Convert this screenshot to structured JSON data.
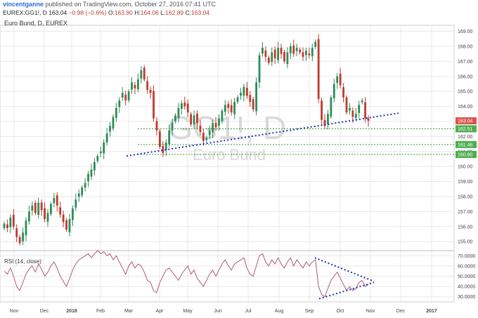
{
  "header": {
    "user": "vincentganne",
    "published": "published on TradingView.com, October 27, 2016 07:41 UTC",
    "symbol": "EUREX:GG1!, D",
    "last": "163.04",
    "change": "−0.98 (−0.6%)",
    "o_label": "O:",
    "open": "163.90",
    "h_label": "H:",
    "high": "164.06",
    "l_label": "L:",
    "low": "162.89",
    "c_label": "C:",
    "close": "163.04"
  },
  "chart_title": "Euro Bund, D, EUREX",
  "watermark": {
    "symbol": "GG1!, D",
    "name": "Euro Bund"
  },
  "rsi_title": "RSI (14, close)",
  "colors": {
    "up": "#2e8b57",
    "down": "#c0392b",
    "rsi": "#b05a7a",
    "trendline": "#1a2fb8",
    "support": "#3a9a3a",
    "price_tag": "#d9534f",
    "support_tag": "#4caf50",
    "grid": "#e8e8e8"
  },
  "chart_data": [
    {
      "type": "candlestick",
      "title": "Euro Bund, D, EUREX",
      "ylim": [
        154.4,
        169.4
      ],
      "y_ticks": [
        "155.00",
        "156.00",
        "157.00",
        "158.00",
        "159.00",
        "160.00",
        "161.00",
        "162.00",
        "163.00",
        "164.00",
        "165.00",
        "166.00",
        "167.00",
        "168.00",
        "169.00"
      ],
      "x_ticks": [
        "Nov",
        "Dec",
        "2016",
        "Feb",
        "Mar",
        "Apr",
        "May",
        "Jun",
        "Jul",
        "Aug",
        "Sep",
        "Oct",
        "Nov",
        "Dec",
        "2017"
      ],
      "last_price": "163.04",
      "support_levels": [
        "162.51",
        "161.46",
        "160.80"
      ],
      "trendline": {
        "start": [
          "Mar",
          160.7
        ],
        "end": [
          "Nov",
          163.55
        ]
      },
      "close_series": [
        156.2,
        155.9,
        156.6,
        156.0,
        155.3,
        154.9,
        155.6,
        156.4,
        157.0,
        157.4,
        156.9,
        157.6,
        157.1,
        156.5,
        156.9,
        157.5,
        157.9,
        157.4,
        156.8,
        156.3,
        155.8,
        156.5,
        157.2,
        157.8,
        158.2,
        158.6,
        158.9,
        159.5,
        159.8,
        160.3,
        160.7,
        161.0,
        161.6,
        162.2,
        162.7,
        163.3,
        163.9,
        164.4,
        164.9,
        164.4,
        165.0,
        165.6,
        165.2,
        165.8,
        166.4,
        165.8,
        165.1,
        164.9,
        163.2,
        162.4,
        161.3,
        160.9,
        161.6,
        162.4,
        162.9,
        163.4,
        163.9,
        164.2,
        164.0,
        163.6,
        162.8,
        163.4,
        162.9,
        162.3,
        161.7,
        161.9,
        162.4,
        162.9,
        162.6,
        163.2,
        163.7,
        164.1,
        163.9,
        163.6,
        164.3,
        164.6,
        164.9,
        165.3,
        164.7,
        164.3,
        163.8,
        165.6,
        167.4,
        167.9,
        167.3,
        166.9,
        167.6,
        167.2,
        167.9,
        167.5,
        167.0,
        167.6,
        168.0,
        167.5,
        167.9,
        167.6,
        167.3,
        167.7,
        167.4,
        167.9,
        168.3,
        164.5,
        163.1,
        162.7,
        163.5,
        164.6,
        165.5,
        166.0,
        165.4,
        164.6,
        163.6,
        163.9,
        163.3,
        163.5,
        164.1,
        164.4,
        163.2,
        163.04
      ],
      "rsi_ylim": [
        25,
        75
      ],
      "rsi_ticks": [
        "30.0000",
        "40.0000",
        "50.0000",
        "60.0000",
        "70.0000"
      ],
      "rsi_series": [
        55,
        52,
        58,
        50,
        40,
        36,
        44,
        52,
        57,
        60,
        54,
        62,
        57,
        50,
        54,
        60,
        64,
        58,
        50,
        45,
        40,
        48,
        56,
        62,
        66,
        68,
        70,
        72,
        68,
        72,
        75,
        72,
        74,
        70,
        72,
        66,
        70,
        64,
        58,
        52,
        60,
        64,
        58,
        62,
        60,
        54,
        46,
        44,
        36,
        34,
        44,
        50,
        56,
        58,
        54,
        50,
        46,
        52,
        56,
        60,
        52,
        56,
        48,
        44,
        40,
        46,
        52,
        56,
        50,
        56,
        62,
        66,
        60,
        56,
        62,
        64,
        66,
        68,
        58,
        52,
        50,
        60,
        70,
        72,
        64,
        60,
        66,
        62,
        68,
        62,
        58,
        64,
        68,
        60,
        66,
        62,
        58,
        64,
        60,
        64,
        66,
        40,
        32,
        30,
        38,
        46,
        50,
        54,
        48,
        42,
        36,
        40,
        36,
        38,
        44,
        46,
        40,
        42
      ]
    }
  ]
}
